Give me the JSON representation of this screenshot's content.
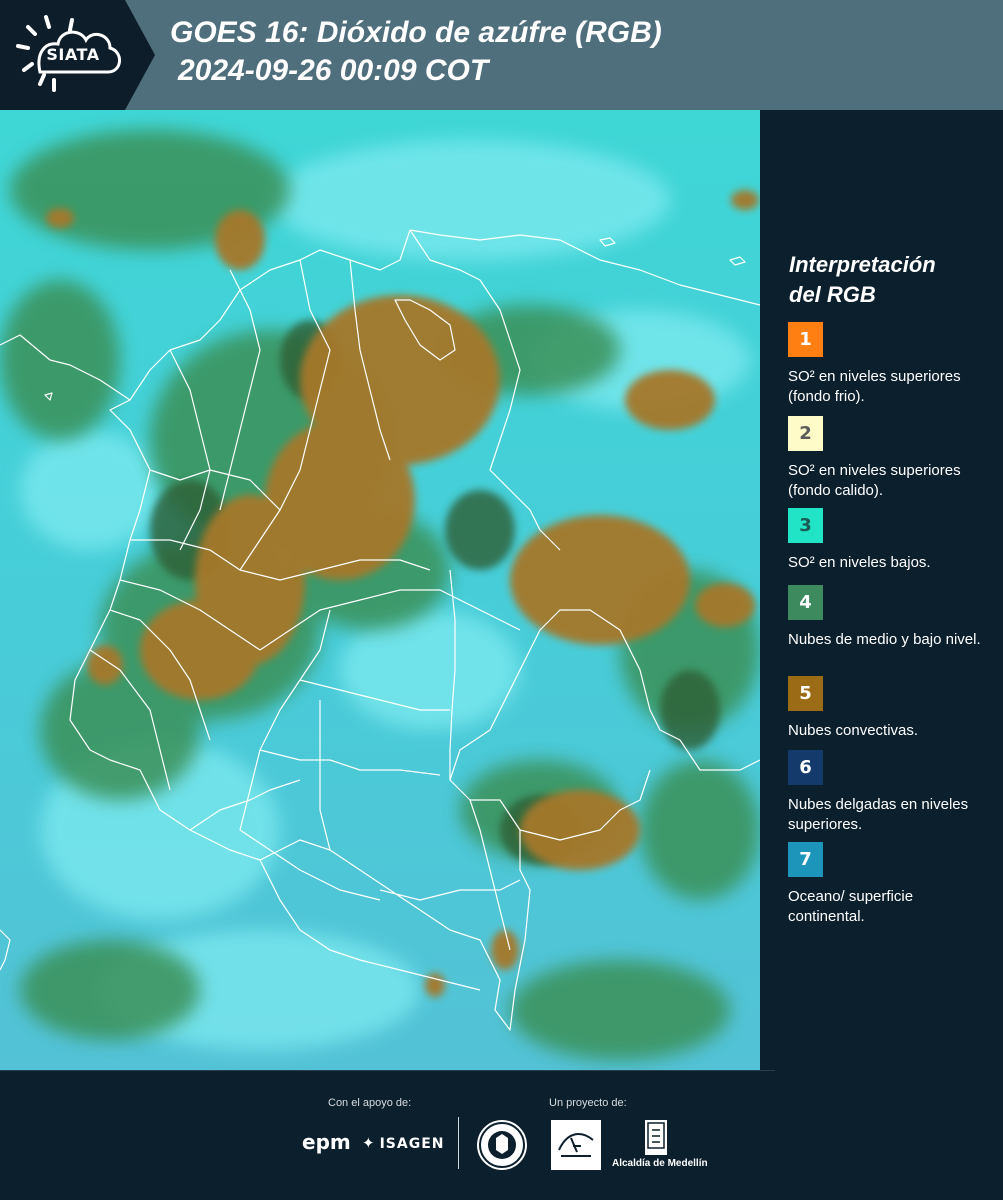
{
  "header": {
    "logo_text": "SIATA",
    "title_line1": "GOES 16: Dióxido de azúfre (RGB)",
    "title_line2": "2024-09-26 00:09 COT"
  },
  "map": {
    "alt": "Composición RGB de dióxido de azufre sobre Colombia"
  },
  "legend": {
    "title_line1": "Interpretación",
    "title_line2": "del RGB",
    "items": [
      {
        "number": "1",
        "label": "SO² en niveles superiores (fondo frio).",
        "color": "#ff7f12",
        "text_color": "#ffffff"
      },
      {
        "number": "2",
        "label": "SO² en niveles superiores (fondo calido).",
        "color": "#fffbc8",
        "text_color": "#5a5a5a"
      },
      {
        "number": "3",
        "label": "SO² en niveles bajos.",
        "color": "#21e3c6",
        "text_color": "#1c5a55"
      },
      {
        "number": "4",
        "label": "Nubes de medio y bajo nivel.",
        "color": "#3d8a5f",
        "text_color": "#ffffff"
      },
      {
        "number": "5",
        "label": "Nubes convectivas.",
        "color": "#9c6b15",
        "text_color": "#ffffff"
      },
      {
        "number": "6",
        "label": "Nubes delgadas en niveles superiores.",
        "color": "#143a6b",
        "text_color": "#ffffff"
      },
      {
        "number": "7",
        "label": "Oceano/ superficie continental.",
        "color": "#1d95ba",
        "text_color": "#ffffff"
      }
    ]
  },
  "footer": {
    "support_label": "Con el apoyo de:",
    "project_label": "Un proyecto de:",
    "epm_logo": "epm",
    "isagen_logo": "ISAGEN",
    "alcaldia_text": "Alcaldía de Medellín"
  }
}
